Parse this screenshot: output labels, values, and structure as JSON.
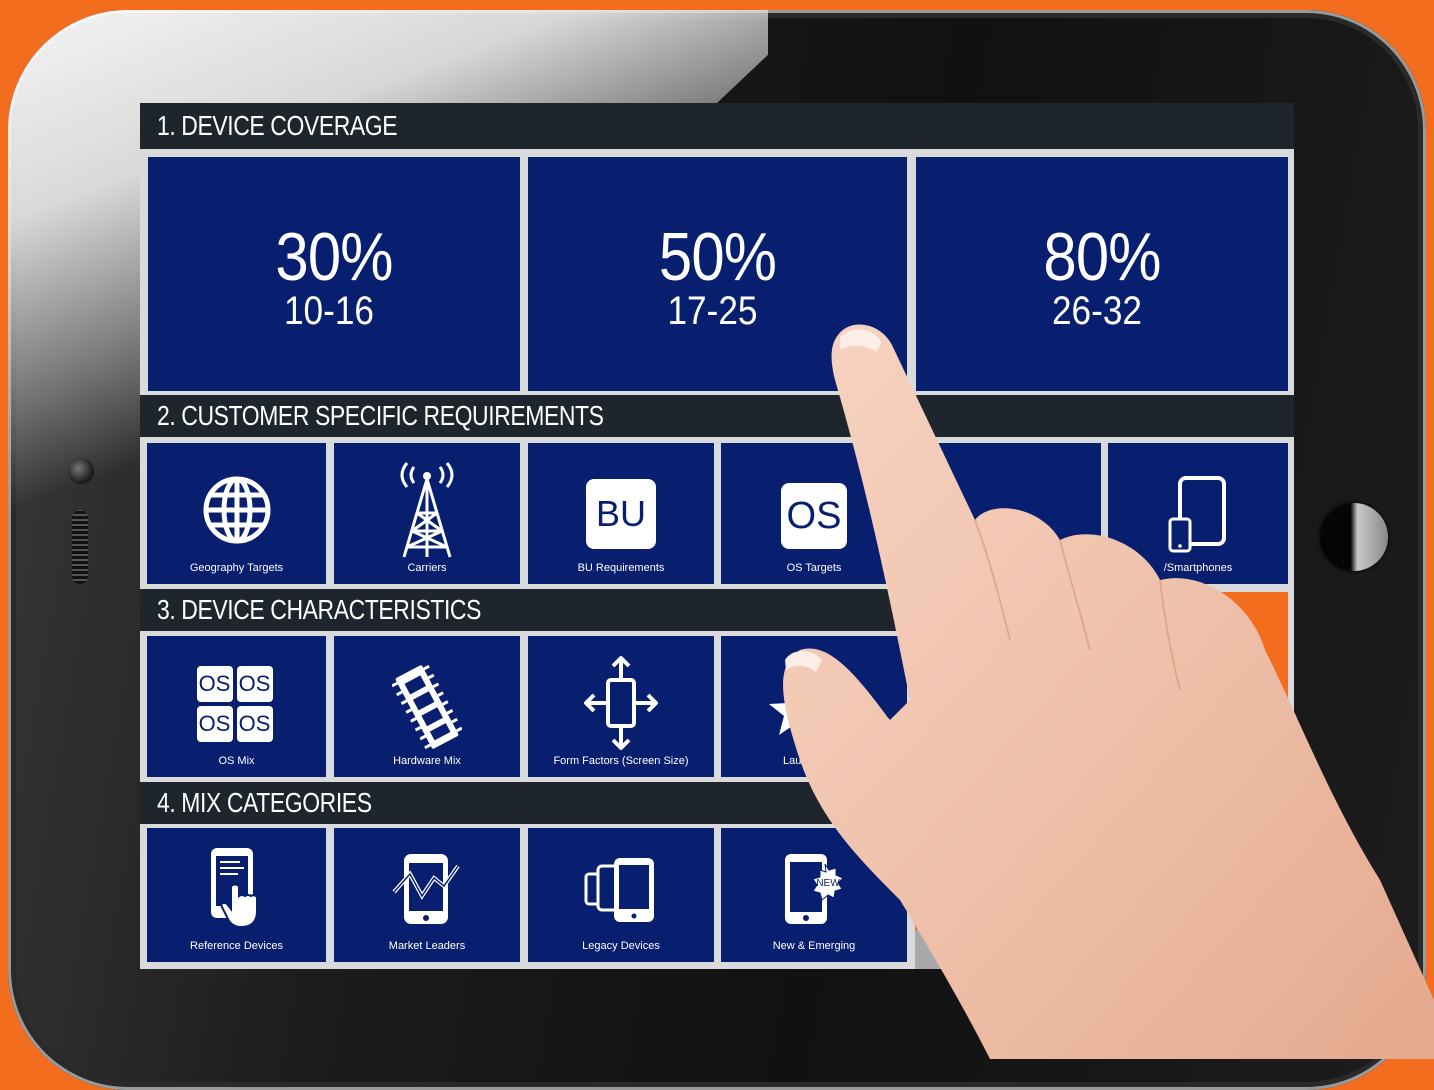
{
  "sections": {
    "coverage": {
      "title": "1. DEVICE COVERAGE",
      "tiles": [
        {
          "percent": "30%",
          "range": "10-16"
        },
        {
          "percent": "50%",
          "range": "17-25"
        },
        {
          "percent": "80%",
          "range": "26-32"
        }
      ]
    },
    "requirements": {
      "title": "2. CUSTOMER SPECIFIC REQUIREMENTS",
      "tiles": [
        {
          "label": "Geography Targets",
          "icon": "globe-icon"
        },
        {
          "label": "Carriers",
          "icon": "cell-tower-icon"
        },
        {
          "label": "BU Requirements",
          "icon": "bu-badge-icon",
          "badge": "BU"
        },
        {
          "label": "OS Targets",
          "icon": "os-badge-icon",
          "badge": "OS"
        },
        {
          "label": "",
          "icon": "partial-icon"
        },
        {
          "label": "/Smartphones",
          "icon": "tablet-phone-icon"
        }
      ]
    },
    "characteristics": {
      "title": "3. DEVICE CHARACTERISTICS",
      "tiles": [
        {
          "label": "OS Mix",
          "icon": "os-grid-icon",
          "badge": "OS"
        },
        {
          "label": "Hardware Mix",
          "icon": "memory-chip-icon"
        },
        {
          "label": "Form Factors (Screen Size)",
          "icon": "resize-arrows-icon"
        },
        {
          "label": "Launch",
          "icon": "star-icon"
        }
      ]
    },
    "mix": {
      "title": "4. MIX CATEGORIES",
      "tiles": [
        {
          "label": "Reference Devices",
          "icon": "phone-touch-icon"
        },
        {
          "label": "Market Leaders",
          "icon": "phone-trend-icon"
        },
        {
          "label": "Legacy Devices",
          "icon": "stacked-phones-icon"
        },
        {
          "label": "New & Emerging",
          "icon": "phone-new-icon",
          "badge": "NEW"
        }
      ]
    }
  },
  "colors": {
    "tile": "#071f6e",
    "header": "#1f252d",
    "accent": "#f26d1e",
    "screen_bg": "#d9dadb"
  }
}
